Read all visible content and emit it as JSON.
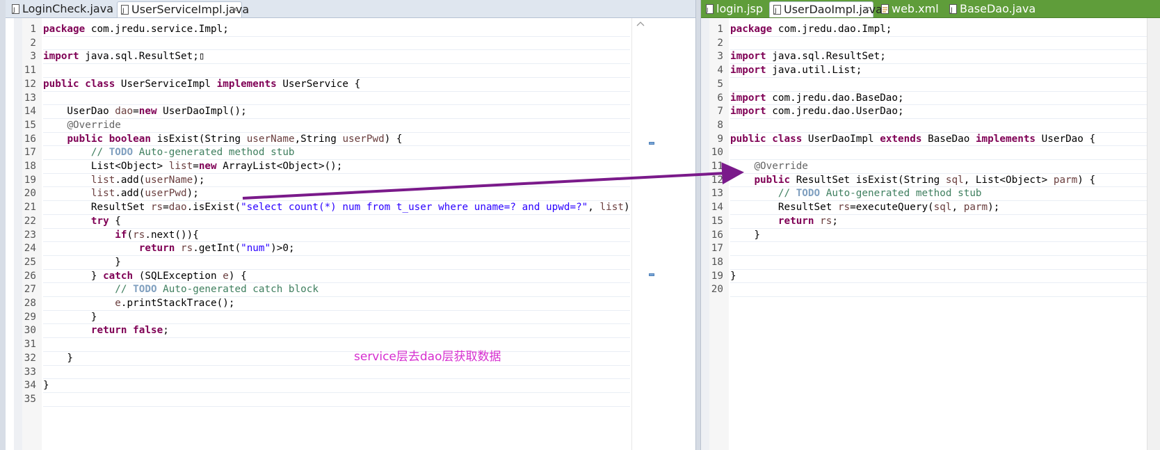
{
  "left_editor": {
    "tabs": [
      {
        "label": "LoginCheck.java",
        "active": false
      },
      {
        "label": "UserServiceImpl.java",
        "active": true
      }
    ],
    "line_numbers": [
      "1",
      "2",
      "3",
      "11",
      "12",
      "13",
      "14",
      "15",
      "16",
      "17",
      "18",
      "19",
      "20",
      "21",
      "22",
      "23",
      "24",
      "25",
      "26",
      "27",
      "28",
      "29",
      "30",
      "31",
      "32",
      "33",
      "34",
      "35"
    ],
    "lines": [
      [
        {
          "t": "package",
          "c": "kw"
        },
        {
          "t": " com.jredu.service.Impl;"
        }
      ],
      [],
      [
        {
          "t": "import",
          "c": "kw"
        },
        {
          "t": " java.sql.ResultSet;"
        },
        {
          "t": "▯"
        }
      ],
      [],
      [
        {
          "t": "public",
          "c": "kw"
        },
        {
          "t": " "
        },
        {
          "t": "class",
          "c": "kw"
        },
        {
          "t": " UserServiceImpl "
        },
        {
          "t": "implements",
          "c": "kw"
        },
        {
          "t": " UserService {"
        }
      ],
      [],
      [
        {
          "t": "    UserDao "
        },
        {
          "t": "dao",
          "c": "var"
        },
        {
          "t": "="
        },
        {
          "t": "new",
          "c": "kw"
        },
        {
          "t": " UserDaoImpl();"
        }
      ],
      [
        {
          "t": "    "
        },
        {
          "t": "@Override",
          "c": "ann"
        }
      ],
      [
        {
          "t": "    "
        },
        {
          "t": "public",
          "c": "kw"
        },
        {
          "t": " "
        },
        {
          "t": "boolean",
          "c": "kw"
        },
        {
          "t": " isExist(String "
        },
        {
          "t": "userName",
          "c": "var"
        },
        {
          "t": ",String "
        },
        {
          "t": "userPwd",
          "c": "var"
        },
        {
          "t": ") {"
        }
      ],
      [
        {
          "t": "        "
        },
        {
          "t": "// ",
          "c": "cm"
        },
        {
          "t": "TODO",
          "c": "todo"
        },
        {
          "t": " Auto-generated method stub",
          "c": "cm"
        }
      ],
      [
        {
          "t": "        List<Object> "
        },
        {
          "t": "list",
          "c": "var"
        },
        {
          "t": "="
        },
        {
          "t": "new",
          "c": "kw"
        },
        {
          "t": " ArrayList<Object>();"
        }
      ],
      [
        {
          "t": "        "
        },
        {
          "t": "list",
          "c": "var"
        },
        {
          "t": ".add("
        },
        {
          "t": "userName",
          "c": "var"
        },
        {
          "t": ");"
        }
      ],
      [
        {
          "t": "        "
        },
        {
          "t": "list",
          "c": "var"
        },
        {
          "t": ".add("
        },
        {
          "t": "userPwd",
          "c": "var"
        },
        {
          "t": ");"
        }
      ],
      [
        {
          "t": "        ResultSet "
        },
        {
          "t": "rs",
          "c": "var"
        },
        {
          "t": "="
        },
        {
          "t": "dao",
          "c": "var"
        },
        {
          "t": ".isExist("
        },
        {
          "t": "\"select count(*) num from t_user where uname=? and upwd=?\"",
          "c": "str"
        },
        {
          "t": ", "
        },
        {
          "t": "list",
          "c": "var"
        },
        {
          "t": ");"
        }
      ],
      [
        {
          "t": "        "
        },
        {
          "t": "try",
          "c": "kw"
        },
        {
          "t": " {"
        }
      ],
      [
        {
          "t": "            "
        },
        {
          "t": "if",
          "c": "kw"
        },
        {
          "t": "("
        },
        {
          "t": "rs",
          "c": "var"
        },
        {
          "t": ".next()){"
        }
      ],
      [
        {
          "t": "                "
        },
        {
          "t": "return",
          "c": "kw"
        },
        {
          "t": " "
        },
        {
          "t": "rs",
          "c": "var"
        },
        {
          "t": ".getInt("
        },
        {
          "t": "\"num\"",
          "c": "str"
        },
        {
          "t": ")>0;"
        }
      ],
      [
        {
          "t": "            }"
        }
      ],
      [
        {
          "t": "        } "
        },
        {
          "t": "catch",
          "c": "kw"
        },
        {
          "t": " (SQLException "
        },
        {
          "t": "e",
          "c": "var"
        },
        {
          "t": ") {"
        }
      ],
      [
        {
          "t": "            "
        },
        {
          "t": "// ",
          "c": "cm"
        },
        {
          "t": "TODO",
          "c": "todo"
        },
        {
          "t": " Auto-generated catch block",
          "c": "cm"
        }
      ],
      [
        {
          "t": "            "
        },
        {
          "t": "e",
          "c": "var"
        },
        {
          "t": ".printStackTrace();"
        }
      ],
      [
        {
          "t": "        }"
        }
      ],
      [
        {
          "t": "        "
        },
        {
          "t": "return",
          "c": "kw"
        },
        {
          "t": " "
        },
        {
          "t": "false",
          "c": "kw"
        },
        {
          "t": ";"
        }
      ],
      [],
      [
        {
          "t": "    }"
        }
      ],
      [],
      [
        {
          "t": "}"
        }
      ],
      []
    ]
  },
  "right_editor": {
    "tabs": [
      {
        "label": "login.jsp",
        "active": false
      },
      {
        "label": "UserDaoImpl.java",
        "active": true
      },
      {
        "label": "web.xml",
        "active": false
      },
      {
        "label": "BaseDao.java",
        "active": false
      }
    ],
    "line_numbers": [
      "1",
      "2",
      "3",
      "4",
      "5",
      "6",
      "7",
      "8",
      "9",
      "10",
      "11",
      "12",
      "13",
      "14",
      "15",
      "16",
      "17",
      "18",
      "19",
      "20"
    ],
    "lines": [
      [
        {
          "t": "package",
          "c": "kw"
        },
        {
          "t": " com.jredu.dao.Impl;"
        }
      ],
      [],
      [
        {
          "t": "import",
          "c": "kw"
        },
        {
          "t": " java.sql.ResultSet;"
        }
      ],
      [
        {
          "t": "import",
          "c": "kw"
        },
        {
          "t": " java.util.List;"
        }
      ],
      [],
      [
        {
          "t": "import",
          "c": "kw"
        },
        {
          "t": " com.jredu.dao.BaseDao;"
        }
      ],
      [
        {
          "t": "import",
          "c": "kw"
        },
        {
          "t": " com.jredu.dao.UserDao;"
        }
      ],
      [],
      [
        {
          "t": "public",
          "c": "kw"
        },
        {
          "t": " "
        },
        {
          "t": "class",
          "c": "kw"
        },
        {
          "t": " UserDaoImpl "
        },
        {
          "t": "extends",
          "c": "kw"
        },
        {
          "t": " BaseDao "
        },
        {
          "t": "implements",
          "c": "kw"
        },
        {
          "t": " UserDao {"
        }
      ],
      [],
      [
        {
          "t": "    "
        },
        {
          "t": "@Override",
          "c": "ann"
        }
      ],
      [
        {
          "t": "    "
        },
        {
          "t": "public",
          "c": "kw"
        },
        {
          "t": " ResultSet isExist(String "
        },
        {
          "t": "sql",
          "c": "var"
        },
        {
          "t": ", List<Object> "
        },
        {
          "t": "parm",
          "c": "var"
        },
        {
          "t": ") {"
        }
      ],
      [
        {
          "t": "        "
        },
        {
          "t": "// ",
          "c": "cm"
        },
        {
          "t": "TODO",
          "c": "todo"
        },
        {
          "t": " Auto-generated method stub",
          "c": "cm"
        }
      ],
      [
        {
          "t": "        ResultSet "
        },
        {
          "t": "rs",
          "c": "var"
        },
        {
          "t": "=executeQuery("
        },
        {
          "t": "sql",
          "c": "var"
        },
        {
          "t": ", "
        },
        {
          "t": "parm",
          "c": "var"
        },
        {
          "t": ");"
        }
      ],
      [
        {
          "t": "        "
        },
        {
          "t": "return",
          "c": "kw"
        },
        {
          "t": " "
        },
        {
          "t": "rs",
          "c": "var"
        },
        {
          "t": ";"
        }
      ],
      [
        {
          "t": "    }"
        }
      ],
      [],
      [],
      [
        {
          "t": "}"
        }
      ],
      []
    ]
  },
  "annotation": {
    "text": "service层去dao层获取数据",
    "color": "#d62fd0",
    "arrow_color": "#7a1a8a"
  },
  "colors": {
    "keyword": "#7f0055",
    "string": "#2a00ff",
    "comment": "#3f7f5f",
    "todo": "#7f9fbf",
    "annotation": "#646464",
    "variable": "#6a3e3e",
    "right_tabbar": "#5f9d3a"
  }
}
